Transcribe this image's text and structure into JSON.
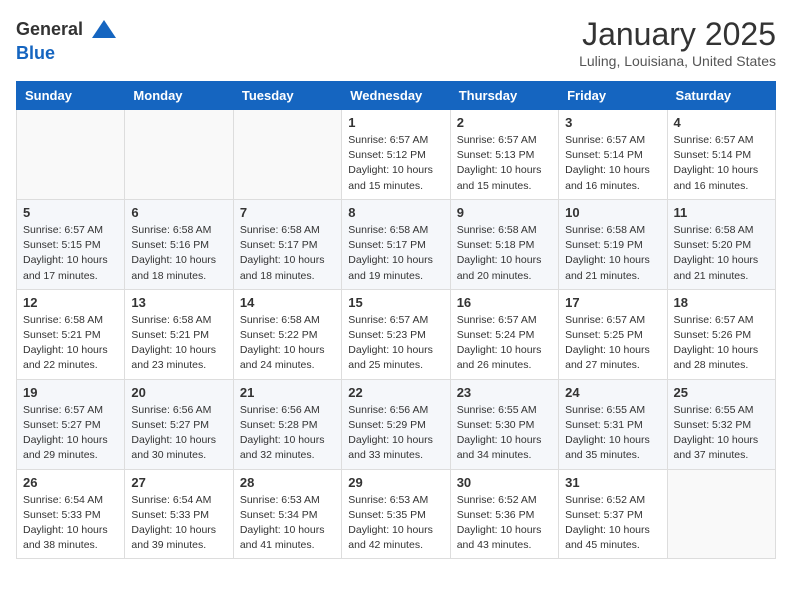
{
  "header": {
    "logo_line1": "General",
    "logo_line2": "Blue",
    "month": "January 2025",
    "location": "Luling, Louisiana, United States"
  },
  "weekdays": [
    "Sunday",
    "Monday",
    "Tuesday",
    "Wednesday",
    "Thursday",
    "Friday",
    "Saturday"
  ],
  "weeks": [
    [
      {
        "day": "",
        "info": ""
      },
      {
        "day": "",
        "info": ""
      },
      {
        "day": "",
        "info": ""
      },
      {
        "day": "1",
        "info": "Sunrise: 6:57 AM\nSunset: 5:12 PM\nDaylight: 10 hours\nand 15 minutes."
      },
      {
        "day": "2",
        "info": "Sunrise: 6:57 AM\nSunset: 5:13 PM\nDaylight: 10 hours\nand 15 minutes."
      },
      {
        "day": "3",
        "info": "Sunrise: 6:57 AM\nSunset: 5:14 PM\nDaylight: 10 hours\nand 16 minutes."
      },
      {
        "day": "4",
        "info": "Sunrise: 6:57 AM\nSunset: 5:14 PM\nDaylight: 10 hours\nand 16 minutes."
      }
    ],
    [
      {
        "day": "5",
        "info": "Sunrise: 6:57 AM\nSunset: 5:15 PM\nDaylight: 10 hours\nand 17 minutes."
      },
      {
        "day": "6",
        "info": "Sunrise: 6:58 AM\nSunset: 5:16 PM\nDaylight: 10 hours\nand 18 minutes."
      },
      {
        "day": "7",
        "info": "Sunrise: 6:58 AM\nSunset: 5:17 PM\nDaylight: 10 hours\nand 18 minutes."
      },
      {
        "day": "8",
        "info": "Sunrise: 6:58 AM\nSunset: 5:17 PM\nDaylight: 10 hours\nand 19 minutes."
      },
      {
        "day": "9",
        "info": "Sunrise: 6:58 AM\nSunset: 5:18 PM\nDaylight: 10 hours\nand 20 minutes."
      },
      {
        "day": "10",
        "info": "Sunrise: 6:58 AM\nSunset: 5:19 PM\nDaylight: 10 hours\nand 21 minutes."
      },
      {
        "day": "11",
        "info": "Sunrise: 6:58 AM\nSunset: 5:20 PM\nDaylight: 10 hours\nand 21 minutes."
      }
    ],
    [
      {
        "day": "12",
        "info": "Sunrise: 6:58 AM\nSunset: 5:21 PM\nDaylight: 10 hours\nand 22 minutes."
      },
      {
        "day": "13",
        "info": "Sunrise: 6:58 AM\nSunset: 5:21 PM\nDaylight: 10 hours\nand 23 minutes."
      },
      {
        "day": "14",
        "info": "Sunrise: 6:58 AM\nSunset: 5:22 PM\nDaylight: 10 hours\nand 24 minutes."
      },
      {
        "day": "15",
        "info": "Sunrise: 6:57 AM\nSunset: 5:23 PM\nDaylight: 10 hours\nand 25 minutes."
      },
      {
        "day": "16",
        "info": "Sunrise: 6:57 AM\nSunset: 5:24 PM\nDaylight: 10 hours\nand 26 minutes."
      },
      {
        "day": "17",
        "info": "Sunrise: 6:57 AM\nSunset: 5:25 PM\nDaylight: 10 hours\nand 27 minutes."
      },
      {
        "day": "18",
        "info": "Sunrise: 6:57 AM\nSunset: 5:26 PM\nDaylight: 10 hours\nand 28 minutes."
      }
    ],
    [
      {
        "day": "19",
        "info": "Sunrise: 6:57 AM\nSunset: 5:27 PM\nDaylight: 10 hours\nand 29 minutes."
      },
      {
        "day": "20",
        "info": "Sunrise: 6:56 AM\nSunset: 5:27 PM\nDaylight: 10 hours\nand 30 minutes."
      },
      {
        "day": "21",
        "info": "Sunrise: 6:56 AM\nSunset: 5:28 PM\nDaylight: 10 hours\nand 32 minutes."
      },
      {
        "day": "22",
        "info": "Sunrise: 6:56 AM\nSunset: 5:29 PM\nDaylight: 10 hours\nand 33 minutes."
      },
      {
        "day": "23",
        "info": "Sunrise: 6:55 AM\nSunset: 5:30 PM\nDaylight: 10 hours\nand 34 minutes."
      },
      {
        "day": "24",
        "info": "Sunrise: 6:55 AM\nSunset: 5:31 PM\nDaylight: 10 hours\nand 35 minutes."
      },
      {
        "day": "25",
        "info": "Sunrise: 6:55 AM\nSunset: 5:32 PM\nDaylight: 10 hours\nand 37 minutes."
      }
    ],
    [
      {
        "day": "26",
        "info": "Sunrise: 6:54 AM\nSunset: 5:33 PM\nDaylight: 10 hours\nand 38 minutes."
      },
      {
        "day": "27",
        "info": "Sunrise: 6:54 AM\nSunset: 5:33 PM\nDaylight: 10 hours\nand 39 minutes."
      },
      {
        "day": "28",
        "info": "Sunrise: 6:53 AM\nSunset: 5:34 PM\nDaylight: 10 hours\nand 41 minutes."
      },
      {
        "day": "29",
        "info": "Sunrise: 6:53 AM\nSunset: 5:35 PM\nDaylight: 10 hours\nand 42 minutes."
      },
      {
        "day": "30",
        "info": "Sunrise: 6:52 AM\nSunset: 5:36 PM\nDaylight: 10 hours\nand 43 minutes."
      },
      {
        "day": "31",
        "info": "Sunrise: 6:52 AM\nSunset: 5:37 PM\nDaylight: 10 hours\nand 45 minutes."
      },
      {
        "day": "",
        "info": ""
      }
    ]
  ]
}
